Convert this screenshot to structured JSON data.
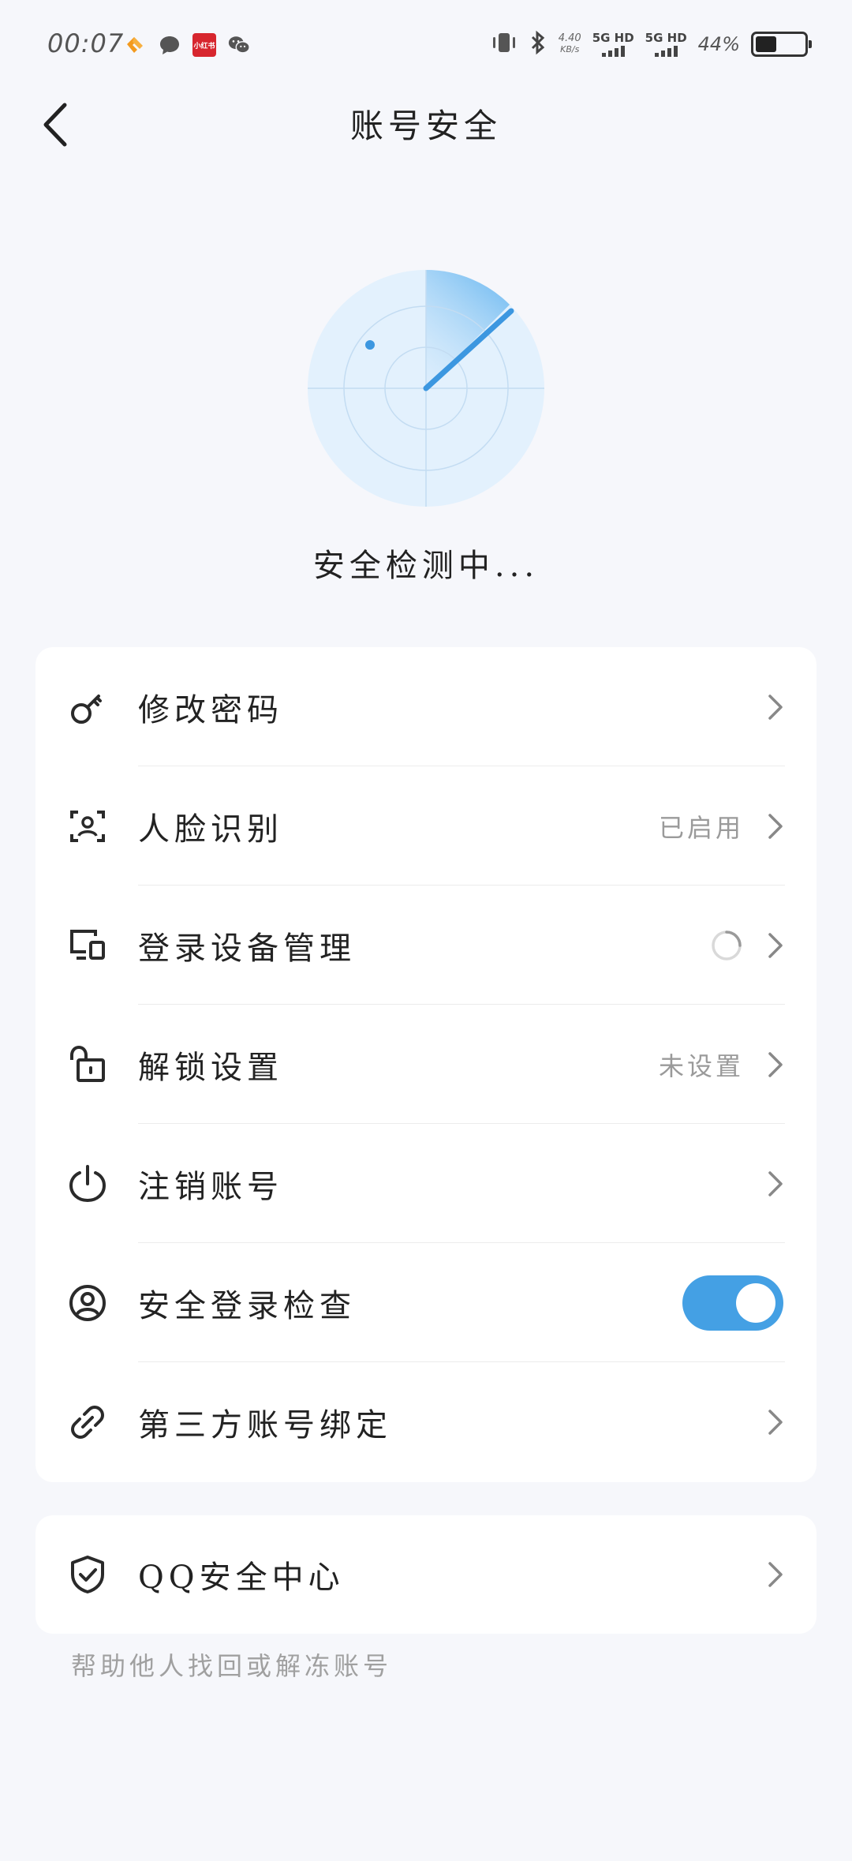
{
  "status_bar": {
    "time": "00:07",
    "net_speed_value": "4.40",
    "net_speed_unit": "KB/s",
    "sim1": "5G HD",
    "sim2": "5G HD",
    "battery_percent": "44%",
    "app_badge": "小红书",
    "battery_level": 0.44
  },
  "header": {
    "title": "账号安全"
  },
  "scan": {
    "status_text": "安全检测中..."
  },
  "settings": {
    "change_password": {
      "label": "修改密码",
      "value": ""
    },
    "face_recognition": {
      "label": "人脸识别",
      "value": "已启用"
    },
    "device_management": {
      "label": "登录设备管理",
      "value": ""
    },
    "unlock_settings": {
      "label": "解锁设置",
      "value": "未设置"
    },
    "cancel_account": {
      "label": "注销账号",
      "value": ""
    },
    "safe_login_check": {
      "label": "安全登录检查",
      "toggle_on": true
    },
    "third_party_binding": {
      "label": "第三方账号绑定",
      "value": ""
    }
  },
  "qq_security": {
    "label": "QQ安全中心"
  },
  "help_link": "帮助他人找回或解冻账号",
  "colors": {
    "accent": "#44a0e4",
    "radar_fill": "#e3f1fd",
    "background": "#f6f7fb"
  }
}
